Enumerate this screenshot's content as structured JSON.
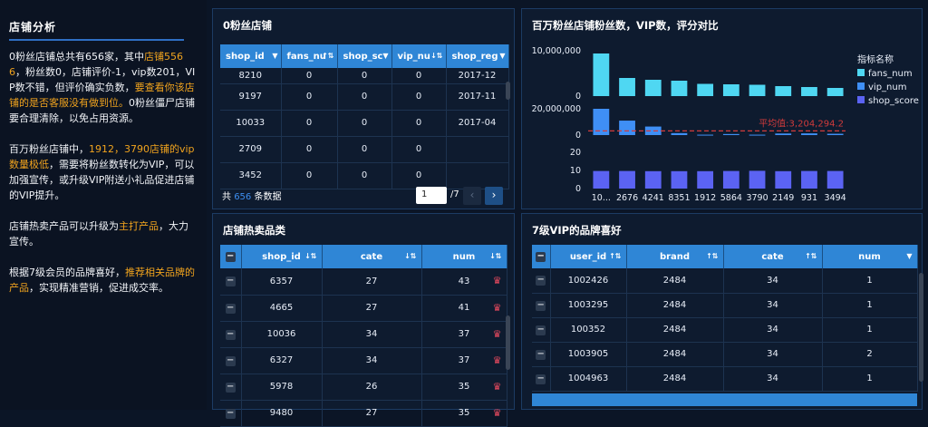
{
  "left": {
    "title": "店铺分析",
    "p1": [
      {
        "t": "0粉丝店铺总共有656家，其中",
        "h": false
      },
      {
        "t": "店铺5566",
        "h": true
      },
      {
        "t": "，粉丝数0，店铺评价-1，vip数201，VIP数不错，但评价确实负数，",
        "h": false
      },
      {
        "t": "要查看你该店铺的是否客服没有做到位。",
        "h": true
      },
      {
        "t": "0粉丝僵尸店铺要合理清除，以免占用资源。",
        "h": false
      }
    ],
    "p2": [
      {
        "t": "百万粉丝店铺中，",
        "h": false
      },
      {
        "t": "1912，3790店铺的vip数量极低",
        "h": true
      },
      {
        "t": "，需要将粉丝数转化为VIP，可以加强宣传，或升级VIP附送小礼品促进店铺的VIP提升。",
        "h": false
      }
    ],
    "p3": [
      {
        "t": "店铺热卖产品可以升级为",
        "h": false
      },
      {
        "t": "主打产品",
        "h": true
      },
      {
        "t": "，大力宣传。",
        "h": false
      }
    ],
    "p4": [
      {
        "t": "根据7级会员的品牌喜好，",
        "h": false
      },
      {
        "t": "推荐相关品牌的产品",
        "h": true
      },
      {
        "t": "，实现精准营销，促进成交率。",
        "h": false
      }
    ]
  },
  "zero_fans": {
    "title": "0粉丝店铺",
    "columns": [
      "shop_id",
      "fans_nu",
      "shop_sc",
      "vip_nu",
      "shop_reg"
    ],
    "rows": [
      [
        "8210",
        "0",
        "0",
        "0",
        "2017-12"
      ],
      [
        "9197",
        "0",
        "0",
        "0",
        "2017-11"
      ],
      [
        "10033",
        "0",
        "0",
        "0",
        "2017-04"
      ],
      [
        "2709",
        "0",
        "0",
        "0",
        ""
      ],
      [
        "3452",
        "0",
        "0",
        "0",
        ""
      ]
    ],
    "total_prefix": "共",
    "total_count": "656",
    "total_suffix": "条数据",
    "page_value": "1",
    "page_total": "/7"
  },
  "hot": {
    "title": "店铺热卖品类",
    "columns": [
      "shop_id",
      "cate",
      "num"
    ],
    "rows": [
      [
        "6357",
        "27",
        "43"
      ],
      [
        "4665",
        "27",
        "41"
      ],
      [
        "10036",
        "34",
        "37"
      ],
      [
        "6327",
        "34",
        "37"
      ],
      [
        "5978",
        "26",
        "35"
      ],
      [
        "9480",
        "27",
        "35"
      ]
    ]
  },
  "vip7": {
    "title": "7级VIP的品牌喜好",
    "columns": [
      "user_id",
      "brand",
      "cate",
      "num"
    ],
    "rows": [
      [
        "1002426",
        "2484",
        "34",
        "1"
      ],
      [
        "1003295",
        "2484",
        "34",
        "1"
      ],
      [
        "100352",
        "2484",
        "34",
        "1"
      ],
      [
        "1003905",
        "2484",
        "34",
        "2"
      ],
      [
        "1004963",
        "2484",
        "34",
        "1"
      ]
    ]
  },
  "chart_title": "百万粉丝店铺粉丝数，VIP数，评分对比",
  "chart_data": {
    "type": "bar",
    "categories": [
      "10...",
      "2676",
      "4241",
      "8351",
      "1912",
      "5864",
      "3790",
      "2149",
      "931",
      "3494"
    ],
    "legend_title": "指标名称",
    "series": [
      {
        "name": "fans_num",
        "color": "#4fd7f2",
        "values": [
          9400000,
          4000000,
          3600000,
          3400000,
          2700000,
          2600000,
          2500000,
          2200000,
          2000000,
          1800000
        ],
        "ticks": [
          "10,000,000",
          "0"
        ],
        "ylim": [
          0,
          10000000
        ]
      },
      {
        "name": "vip_num",
        "color": "#3f8ff5",
        "values": [
          20000000,
          11000000,
          6500000,
          1500000,
          300000,
          800000,
          300000,
          1200000,
          1300000,
          1000000
        ],
        "ticks": [
          "20,000,000",
          "0"
        ],
        "ylim": [
          0,
          20000000
        ]
      },
      {
        "name": "shop_score",
        "color": "#5b63f3",
        "values": [
          9.7,
          9.7,
          9.6,
          9.6,
          9.6,
          9.7,
          9.8,
          9.6,
          9.7,
          9.7
        ],
        "ticks": [
          "20",
          "10",
          "0"
        ],
        "ylim": [
          0,
          20
        ]
      }
    ],
    "markline_label": "平均值:3,204,294.2",
    "markline_value": 3204294.2
  }
}
